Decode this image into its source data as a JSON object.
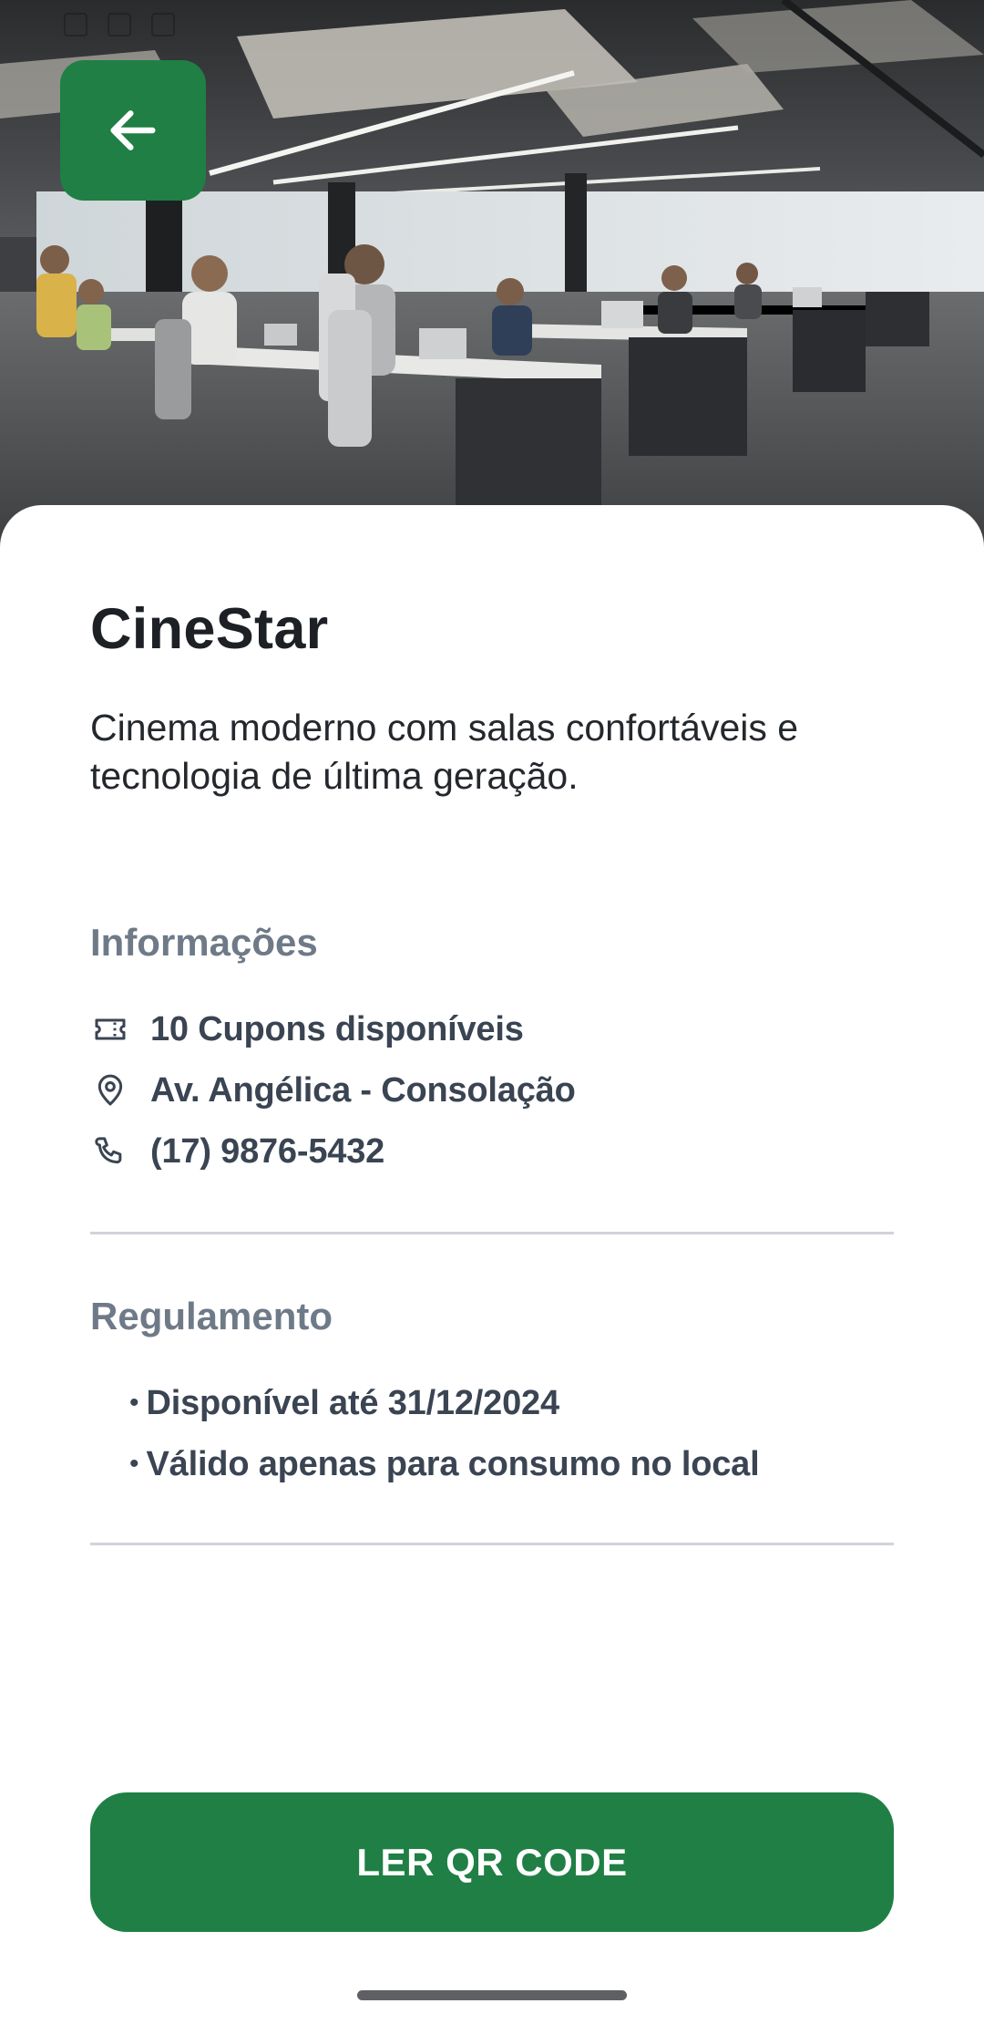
{
  "header": {
    "back_icon": "arrow-left-icon",
    "image_description_icon": "office-photo"
  },
  "place": {
    "name": "CineStar",
    "description": "Cinema moderno com salas confortáveis e tecnologia de última geração."
  },
  "info": {
    "heading": "Informações",
    "items": [
      {
        "icon": "ticket-icon",
        "text": "10 Cupons disponíveis"
      },
      {
        "icon": "location-pin-icon",
        "text": "Av. Angélica - Consolação"
      },
      {
        "icon": "phone-icon",
        "text": "(17) 9876-5432"
      }
    ]
  },
  "rules": {
    "heading": "Regulamento",
    "bullet": "•",
    "items": [
      "Disponível até 31/12/2024",
      "Válido apenas para consumo no local"
    ]
  },
  "actions": {
    "qr_button_label": "LER QR CODE"
  },
  "colors": {
    "primary": "#1f7f45",
    "heading_muted": "#6f7a88",
    "text": "#1d2024"
  }
}
